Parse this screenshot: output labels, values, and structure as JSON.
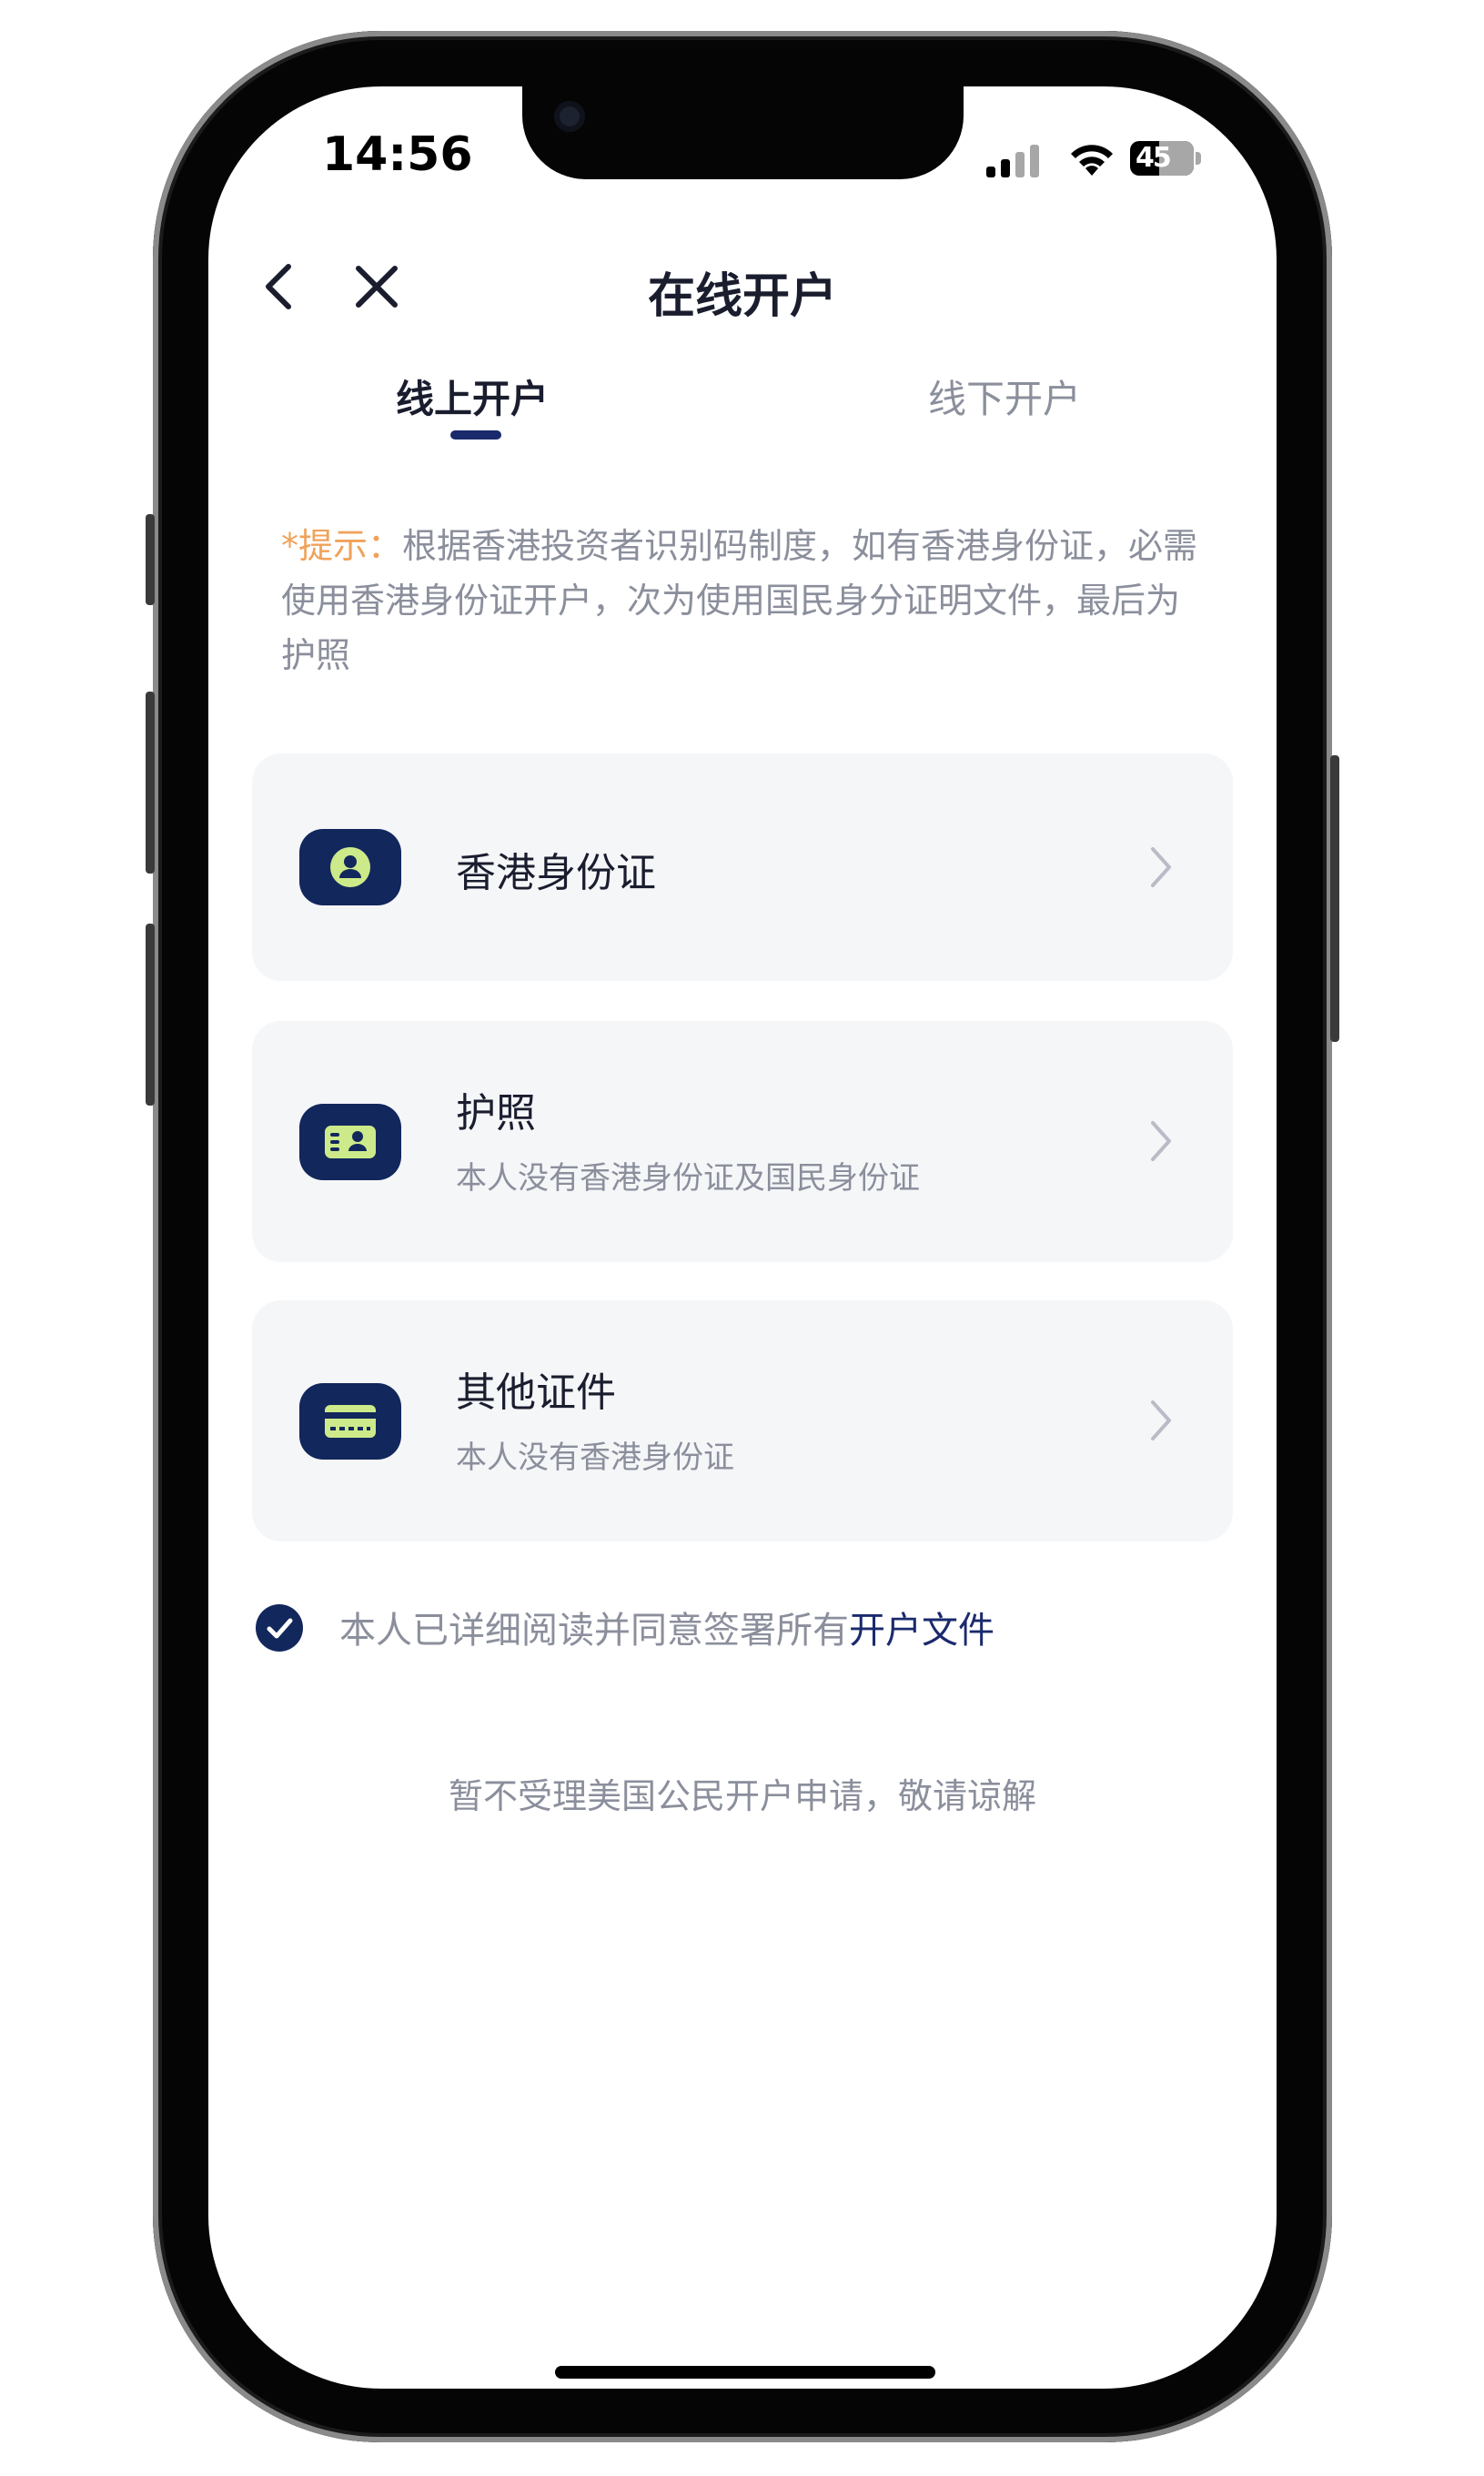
{
  "status_bar": {
    "time": "14:56",
    "battery": "45"
  },
  "nav": {
    "title": "在线开户"
  },
  "tabs": [
    {
      "label": "线上开户",
      "active": true
    },
    {
      "label": "线下开户",
      "active": false
    }
  ],
  "notice": {
    "prefix": "*提示：",
    "text": "根据香港投资者识别码制度，如有香港身份证，必需使用香港身份证开户，次为使用国民身分证明文件，最后为护照"
  },
  "options": [
    {
      "title": "香港身份证",
      "subtitle": "",
      "icon": "id-card-person-icon"
    },
    {
      "title": "护照",
      "subtitle": "本人没有香港身份证及国民身份证",
      "icon": "passport-icon"
    },
    {
      "title": "其他证件",
      "subtitle": "本人没有香港身份证",
      "icon": "other-card-icon"
    }
  ],
  "agreement": {
    "text": "本人已详细阅读并同意签署所有",
    "link": "开户文件",
    "checked": true
  },
  "footer_note": "暂不受理美国公民开户申请，敬请谅解",
  "colors": {
    "primary": "#12275c",
    "hint": "#f0a25a",
    "muted": "#8b8f9c",
    "card_bg": "#f5f6f8"
  }
}
